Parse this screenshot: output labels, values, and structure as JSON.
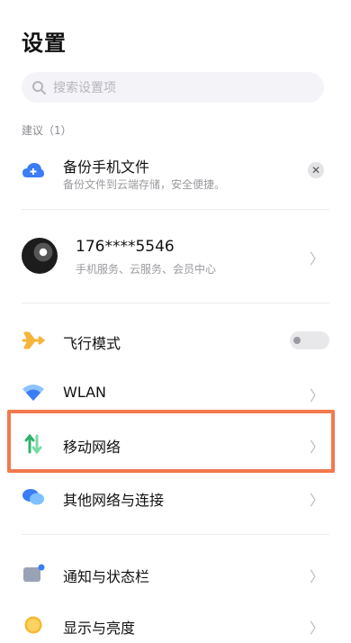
{
  "header": {
    "title": "设置"
  },
  "search": {
    "placeholder": "搜索设置项"
  },
  "suggestion": {
    "section_label": "建议（1）",
    "title": "备份手机文件",
    "subtitle": "备份文件到云端存储，安全便捷。",
    "icon": "cloud-upload-icon"
  },
  "account": {
    "number": "176****5546",
    "subtitle": "手机服务、云服务、会员中心"
  },
  "settings": {
    "airplane": {
      "label": "飞行模式",
      "toggle_on": false,
      "icon": "airplane-icon"
    },
    "wlan": {
      "label": "WLAN",
      "icon": "wifi-icon"
    },
    "mobile": {
      "label": "移动网络",
      "icon": "mobile-network-icon"
    },
    "other_network": {
      "label": "其他网络与连接",
      "icon": "other-network-icon"
    },
    "notification": {
      "label": "通知与状态栏",
      "icon": "notification-icon"
    },
    "display": {
      "label": "显示与亮度",
      "icon": "brightness-icon"
    }
  },
  "colors": {
    "highlight": "#f2794d",
    "accent_blue": "#3a7df5",
    "green": "#2fb36b"
  }
}
